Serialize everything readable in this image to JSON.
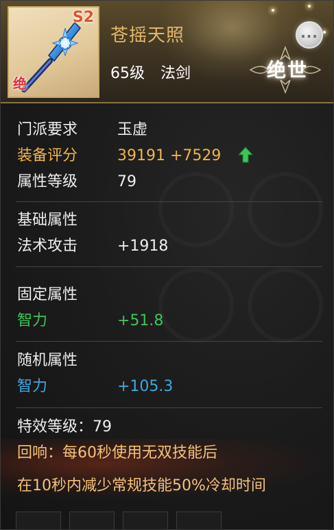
{
  "header": {
    "item_name": "苍摇天照",
    "level": "65级",
    "item_type": "法剑",
    "tier_badge": "S2",
    "quality_mark": "绝",
    "rarity": "绝世",
    "menu_icon": "more-dots-icon"
  },
  "basic_info": [
    {
      "label": "门派要求",
      "value": "玉虚",
      "label_color": "white",
      "value_color": "white"
    },
    {
      "label": "装备评分",
      "value": "39191  +7529",
      "label_color": "gold",
      "value_color": "gold"
    },
    {
      "label": "属性等级",
      "value": "79",
      "label_color": "white",
      "value_color": "white"
    }
  ],
  "base_attributes": {
    "section_title": "基础属性",
    "items": [
      {
        "label": "法术攻击",
        "value": "+1918"
      }
    ]
  },
  "fixed_attributes": {
    "section_title": "固定属性",
    "items": [
      {
        "label": "智力",
        "value": "+51.8"
      }
    ]
  },
  "random_attributes": {
    "section_title": "随机属性",
    "items": [
      {
        "label": "智力",
        "value": "+105.3"
      }
    ]
  },
  "special_effect": {
    "level_text": "特效等级：79",
    "line1": "回响：每60秒使用无双技能后",
    "line2": "在10秒内减少常规技能50%冷却时间"
  },
  "colors": {
    "gold": "#f2b34a",
    "green": "#3fc35a",
    "blue": "#3fa8e0",
    "header_gold": "#e3b76b",
    "score_up_arrow": "#3fc35a"
  }
}
